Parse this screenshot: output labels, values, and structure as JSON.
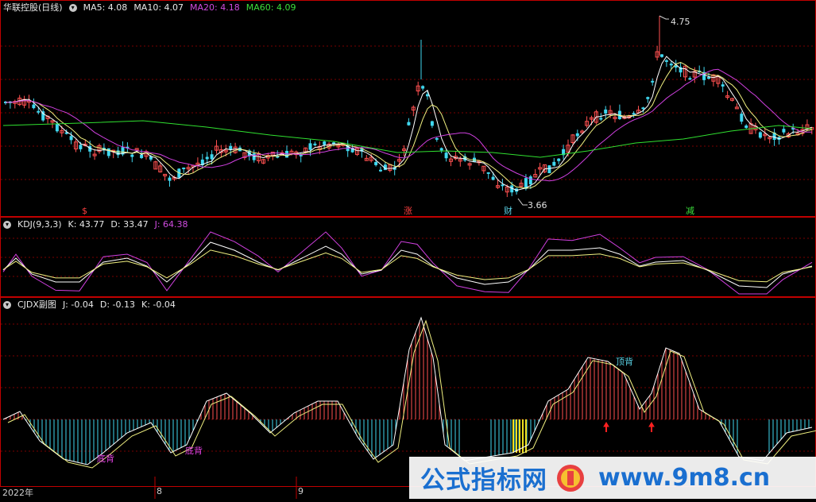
{
  "panel1": {
    "title": "华联控股(日线)",
    "ma5": "MA5: 4.08",
    "ma10": "MA10: 4.07",
    "ma20": "MA20: 4.18",
    "ma60": "MA60: 4.09",
    "high_label": "4.75",
    "low_label": "3.66",
    "markers": [
      "$",
      "涨",
      "财",
      "减"
    ]
  },
  "panel2": {
    "title": "KDJ(9,3,3)",
    "k": "K: 43.77",
    "d": "D: 33.47",
    "j": "J: 64.38"
  },
  "panel3": {
    "title": "CJDX副图",
    "j": "J: -0.04",
    "d": "D: -0.13",
    "k": "K: -0.04",
    "annotations": [
      "底背",
      "底背",
      "顶背"
    ]
  },
  "xaxis": [
    "2022年",
    "8",
    "9"
  ],
  "watermark": {
    "text": "公式指标网",
    "url": "www.9m8.cn"
  },
  "colors": {
    "up": "#ff5050",
    "down": "#40d8f0",
    "ma5": "#ffffff",
    "ma10": "#f0f080",
    "ma20": "#d040e0",
    "ma60": "#30e030",
    "grid": "#800000",
    "border": "#c00000"
  },
  "chart_data": {
    "type": "line",
    "price_range": {
      "high": 4.75,
      "low": 3.66
    }
  }
}
